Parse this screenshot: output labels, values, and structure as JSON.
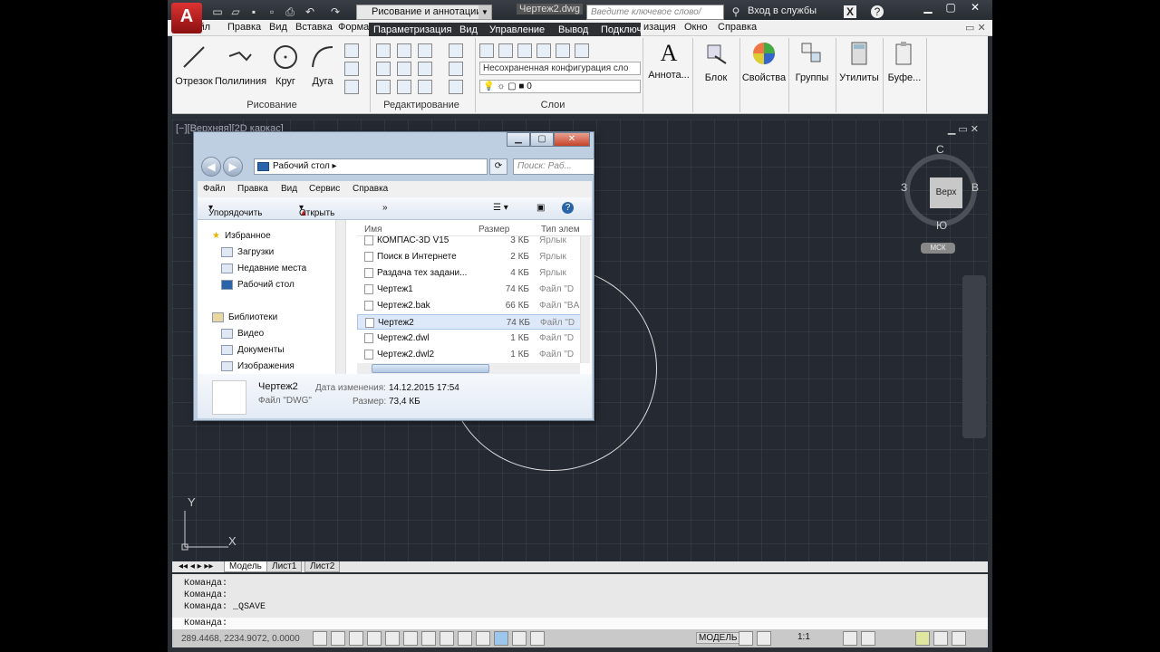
{
  "app": {
    "logo": "A",
    "workspace": "Рисование и аннотации",
    "doc_title": "Чертеж2.dwg",
    "search_placeholder": "Введите ключевое слово/фразу",
    "signin": "Вход в службы"
  },
  "menubar": [
    "Файл",
    "Правка",
    "Вид",
    "Вставка",
    "Форма",
    "Параметризация",
    "Вид",
    "Управление",
    "Вывод",
    "Подключ",
    "изация",
    "Окно",
    "Справка"
  ],
  "ribbon": {
    "draw_buttons": [
      "Отрезок",
      "Полилиния",
      "Круг",
      "Дуга"
    ],
    "panels": [
      "Рисование",
      "Редактирование",
      "Слои"
    ],
    "layer_state": "Несохраненная конфигурация сло",
    "layer_current": "0",
    "right_buttons": [
      "Аннота...",
      "Блок",
      "Свойства",
      "Группы",
      "Утилиты",
      "Буфе..."
    ]
  },
  "viewport": {
    "label": "[−][Верхняя][2D каркас]",
    "viewcube_face": "Верх",
    "compass": {
      "n": "С",
      "s": "Ю",
      "w": "З",
      "e": "В"
    },
    "wcs": "МСК",
    "ucs_y": "Y",
    "ucs_x": "X"
  },
  "layout_tabs": [
    "Модель",
    "Лист1",
    "Лист2"
  ],
  "command": {
    "history": [
      "Команда:",
      "Команда:",
      "Команда:  _QSAVE"
    ],
    "prompt": "Команда:"
  },
  "status": {
    "coords": "289.4468, 2234.9072, 0.0000",
    "model": "МОДЕЛЬ",
    "scale": "1:1"
  },
  "explorer": {
    "address": "Рабочий стол",
    "search_placeholder": "Поиск: Раб...",
    "menu": [
      "Файл",
      "Правка",
      "Вид",
      "Сервис",
      "Справка"
    ],
    "toolbar": {
      "organize": "Упорядочить",
      "open": "Открыть",
      "more": "»"
    },
    "nav": {
      "favorites": "Избранное",
      "downloads": "Загрузки",
      "recent": "Недавние места",
      "desktop": "Рабочий стол",
      "libraries": "Библиотеки",
      "video": "Видео",
      "documents": "Документы",
      "images": "Изображения"
    },
    "columns": [
      "Имя",
      "Размер",
      "Тип элем"
    ],
    "files": [
      {
        "name": "КОМПАС-3D V15",
        "size": "3 КБ",
        "type": "Ярлык"
      },
      {
        "name": "Поиск в Интернете",
        "size": "2 КБ",
        "type": "Ярлык"
      },
      {
        "name": "Раздача тех задани...",
        "size": "4 КБ",
        "type": "Ярлык"
      },
      {
        "name": "Чертеж1",
        "size": "74 КБ",
        "type": "Файл \"D"
      },
      {
        "name": "Чертеж2.bak",
        "size": "66 КБ",
        "type": "Файл \"BA"
      },
      {
        "name": "Чертеж2",
        "size": "74 КБ",
        "type": "Файл \"D"
      },
      {
        "name": "Чертеж2.dwl",
        "size": "1 КБ",
        "type": "Файл \"D"
      },
      {
        "name": "Чертеж2.dwl2",
        "size": "1 КБ",
        "type": "Файл \"D"
      }
    ],
    "selected_index": 5,
    "details": {
      "name": "Чертеж2",
      "type": "Файл \"DWG\"",
      "modified_label": "Дата изменения:",
      "modified": "14.12.2015 17:54",
      "size_label": "Размер:",
      "size": "73,4 КБ"
    }
  }
}
